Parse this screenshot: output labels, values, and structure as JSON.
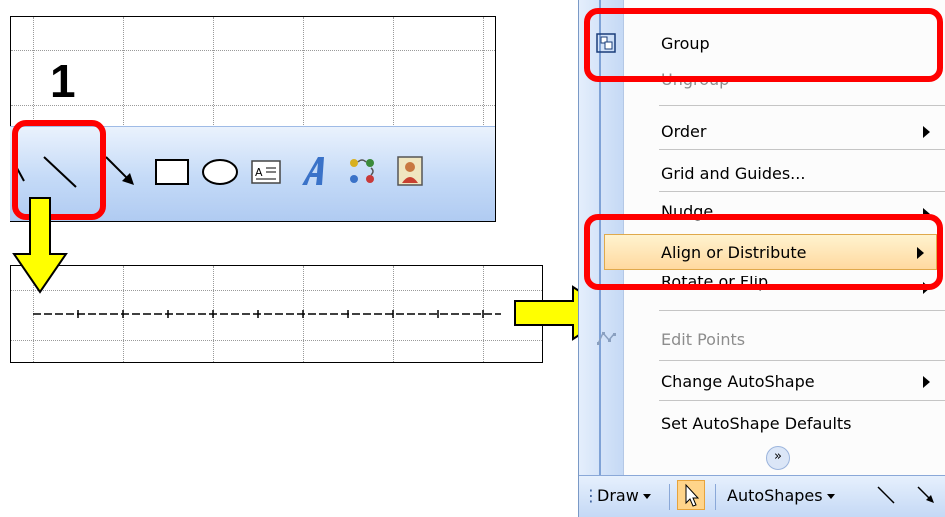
{
  "step_label": "1",
  "menu": {
    "items": [
      {
        "label": "Group",
        "icon": "group-icon",
        "enabled": true,
        "submenu": false
      },
      {
        "label": "Ungroup",
        "icon": "ungroup-icon",
        "enabled": false,
        "submenu": false
      },
      {
        "label": "Order",
        "enabled": true,
        "submenu": true
      },
      {
        "label": "Grid and Guides...",
        "enabled": true,
        "submenu": false
      },
      {
        "label": "Nudge",
        "enabled": true,
        "submenu": true
      },
      {
        "label": "Align or Distribute",
        "enabled": true,
        "submenu": true,
        "highlighted": true
      },
      {
        "label": "Rotate or Flip",
        "enabled": true,
        "submenu": true
      },
      {
        "label": "Edit Points",
        "icon": "edit-points-icon",
        "enabled": false,
        "submenu": false
      },
      {
        "label": "Change AutoShape",
        "enabled": true,
        "submenu": true
      },
      {
        "label": "Set AutoShape Defaults",
        "enabled": true,
        "submenu": false
      }
    ]
  },
  "drawbar": {
    "draw_label": "Draw",
    "autoshapes_label": "AutoShapes"
  },
  "colors": {
    "highlight_red": "#ff0000",
    "arrow_yellow": "#ffff00",
    "menu_highlight": "#ffe2b0"
  }
}
